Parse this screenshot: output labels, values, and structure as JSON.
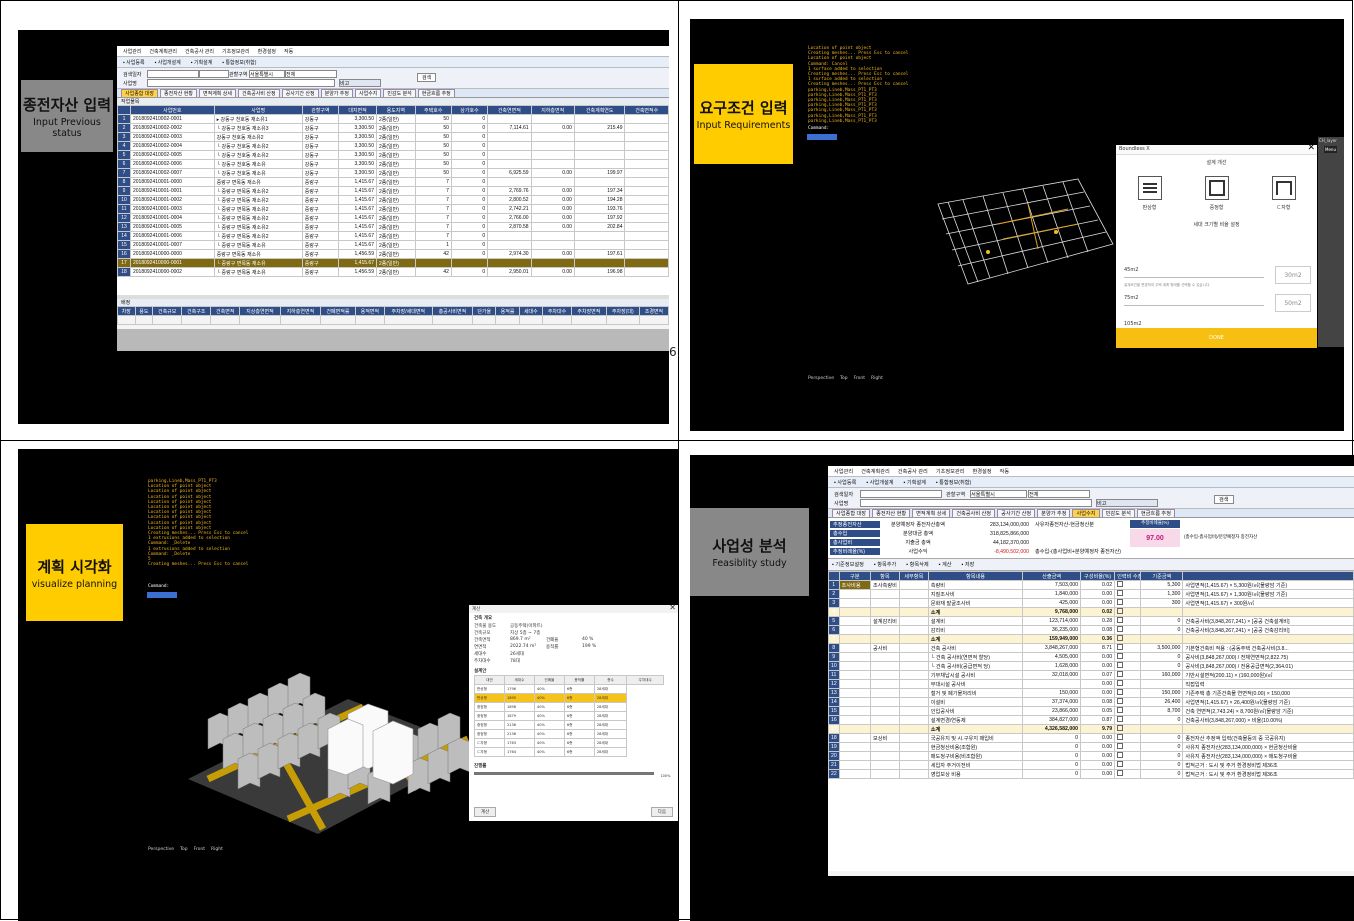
{
  "quadrants": {
    "tl": {
      "title": "종전자산 입력",
      "subtitle": "Input Previous status"
    },
    "tr": {
      "title": "요구조건 입력",
      "subtitle": "Input Requirements"
    },
    "bl": {
      "title": "계획 시각화",
      "subtitle": "visualize planning"
    },
    "br": {
      "title": "사업성 분석",
      "subtitle": "Feasiblity study"
    }
  },
  "page_number_fragment": "615",
  "app": {
    "menu": [
      "사업관리",
      "건축계획관리",
      "건축공사 관리",
      "기초정보관리",
      "환경설정",
      "작동"
    ],
    "toolbar": [
      "사업등록",
      "사업개설계",
      "기획설계",
      "통합정보(취합)"
    ],
    "filter": {
      "label_search": "검색일자",
      "label_name": "사업명",
      "label_region": "관할구역",
      "region_value": "서울특별시",
      "region_value2": "전체",
      "btn_search": "검색",
      "btn_note": "비고"
    },
    "tabs": [
      "사업종합 대장",
      "종전자산 현황",
      "면적계획 상세",
      "건축공사비 산정",
      "공사기간 산정",
      "분양가 추정",
      "사업수지",
      "민감도 분석",
      "현금흐름 추정"
    ]
  },
  "tl_table": {
    "section_label": "작업물목",
    "headers": [
      "사업번호",
      "사업명",
      "관할구역",
      "대지면적",
      "용도지역",
      "주택호수",
      "상가호수",
      "건축연면적",
      "지하층면적",
      "건축계획연도",
      "건축면적수",
      "건축면적비율"
    ],
    "rows": [
      [
        "2018092410002-0001",
        "▸ 강동구 천호동 재소유1",
        "강동구",
        "3,300.50",
        "2종(일반)",
        "50",
        "0",
        "",
        "",
        "",
        ""
      ],
      [
        "2018092410002-0002",
        "└ 강동구 천호동 재소유3",
        "강동구",
        "3,300.50",
        "2종(일반)",
        "50",
        "0",
        "7,114.61",
        "0.00",
        "215.49",
        ""
      ],
      [
        "2018092410002-0003",
        "강동구 천호동 재소유2",
        "강동구",
        "3,300.50",
        "2종(일반)",
        "50",
        "0",
        "",
        "",
        "",
        ""
      ],
      [
        "2018092410002-0004",
        "└ 강동구 천호동 재소유2",
        "강동구",
        "3,300.50",
        "2종(일반)",
        "50",
        "0",
        "",
        "",
        "",
        ""
      ],
      [
        "2018092410002-0005",
        "└ 강동구 천호동 재소유2",
        "강동구",
        "3,300.50",
        "2종(일반)",
        "50",
        "0",
        "",
        "",
        "",
        ""
      ],
      [
        "2018092410002-0006",
        "└ 강동구 천호동 재소유",
        "강동구",
        "3,300.50",
        "2종(일반)",
        "50",
        "0",
        "",
        "",
        "",
        ""
      ],
      [
        "2018092410002-0007",
        "└ 강동구 천호동 재소유",
        "강동구",
        "3,300.50",
        "2종(일반)",
        "50",
        "0",
        "6,925.59",
        "0.00",
        "199.97",
        ""
      ],
      [
        "2018092410001-0000",
        "중랑구 면목동 재소유",
        "중랑구",
        "1,415.67",
        "2종(일반)",
        "7",
        "0",
        "",
        "",
        "",
        ""
      ],
      [
        "2018092410001-0001",
        "└ 중랑구 면목동 재소유2",
        "중랑구",
        "1,415.67",
        "2종(일반)",
        "7",
        "0",
        "2,769.76",
        "0.00",
        "197.34",
        ""
      ],
      [
        "2018092410001-0002",
        "└ 중랑구 면목동 재소유2",
        "중랑구",
        "1,415.67",
        "2종(일반)",
        "7",
        "0",
        "2,800.52",
        "0.00",
        "194.28",
        ""
      ],
      [
        "2018092410001-0003",
        "└ 중랑구 면목동 재소유2",
        "중랑구",
        "1,415.67",
        "2종(일반)",
        "7",
        "0",
        "2,742.21",
        "0.00",
        "193.76",
        ""
      ],
      [
        "2018092410001-0004",
        "└ 중랑구 면목동 재소유2",
        "중랑구",
        "1,415.67",
        "2종(일반)",
        "7",
        "0",
        "2,766.00",
        "0.00",
        "197.92",
        ""
      ],
      [
        "2018092410001-0005",
        "└ 중랑구 면목동 재소유2",
        "중랑구",
        "1,415.67",
        "2종(일반)",
        "7",
        "0",
        "2,870.58",
        "0.00",
        "202.84",
        ""
      ],
      [
        "2018092410001-0006",
        "└ 중랑구 면목동 재소유2",
        "중랑구",
        "1,415.67",
        "2종(일반)",
        "7",
        "0",
        "",
        "",
        "",
        ""
      ],
      [
        "2018092410001-0007",
        "└ 중랑구 면목동 재소유",
        "중랑구",
        "1,415.67",
        "2종(일반)",
        "1",
        "0",
        "",
        "",
        "",
        ""
      ],
      [
        "2018092410000-0000",
        "중랑구 면목동 재소유",
        "중랑구",
        "1,456.59",
        "2종(일반)",
        "42",
        "0",
        "2,974.30",
        "0.00",
        "197.61",
        ""
      ],
      [
        "2018092410000-0001",
        "└ 중랑구 면목동 재소유",
        "중랑구",
        "1,415.67",
        "2종(일반)",
        "",
        "",
        "",
        "",
        "",
        ""
      ],
      [
        "2018092410000-0002",
        "└ 중랑구 면목동 재소유",
        "중랑구",
        "1,456.59",
        "2종(일반)",
        "42",
        "0",
        "2,950.01",
        "0.00",
        "196.98",
        ""
      ]
    ],
    "lower_label": "배정",
    "lower_headers": [
      "차장",
      "용도",
      "건축규모",
      "건축구조",
      "건축면적",
      "지상층연면적",
      "지하층연면적",
      "건폐면적률",
      "용적면적",
      "주차장/세대면적",
      "총공사비면적",
      "단가율",
      "용적률",
      "세대수",
      "주차대수",
      "주차장면적",
      "주차장(대)",
      "조경면적"
    ]
  },
  "tr_cad": {
    "log": [
      "Location of point object",
      "Creating meshes... Press Esc to cancel",
      "Location of point object",
      "Command: Cancel",
      "1 surface added to selection",
      "Creating meshes... Press Esc to cancel",
      "1 surface added to selection",
      "Creating meshes... Press Esc to cancel",
      "parking,Lineb,Mass_PT1_PT3",
      "parking,Lineb,Mass_PT1_PT3",
      "parking,Lineb,Mass_PT1_PT3",
      "parking,Lineb,Mass_PT1_PT3",
      "parking,Lineb,Mass_PT1_PT3",
      "parking,Lineb,Mass_PT1_PT3",
      "parking,Lineb,Mass_PT1_PT3"
    ],
    "command_label": "Command:",
    "views": [
      "Perspective",
      "Top",
      "Front",
      "Right"
    ],
    "dialog": {
      "title": "Boundless X",
      "section1": "설계 개선",
      "types": [
        "판상형",
        "중정형",
        "ㄷ자형"
      ],
      "section2": "세대 크기별 비율 설정",
      "units": [
        {
          "label": "45m2",
          "value": "30m2"
        },
        {
          "label": "75m2",
          "value": "50m2"
        },
        {
          "label": "105m2",
          "value": ""
        }
      ],
      "note": "설계조건을 변경하여 주택 계획 형태를 선택할 수 있습니다.",
      "done": "DONE"
    },
    "side_tab": "Menu",
    "side_label": "CH_layer"
  },
  "bl_cad": {
    "log": [
      "parking,Lineb,Mass_PT1_PT3",
      "Location of point object",
      "Location of point object",
      "Location of point object",
      "Location of point object",
      "Location of point object",
      "Location of point object",
      "Location of point object",
      "Location of point object",
      "Location of point object",
      "Creating meshes... Press Esc to cancel",
      "1 extrusions added to selection",
      "Command: _Delete",
      "1 extrusions added to selection",
      "Command: _Delete",
      "5",
      "Creating meshes... Press Esc to cancel"
    ],
    "command_label": "Command:",
    "views": [
      "Perspective",
      "Top",
      "Front",
      "Right"
    ],
    "panel": {
      "title": "계산",
      "section1": "건축 개요",
      "s1_rows": [
        [
          "건축물 용도",
          "공동주택(아파트)"
        ],
        [
          "건축규모",
          "지상 5층 ~ 7층"
        ],
        [
          "건축면적",
          "869.7 m²",
          "건폐율",
          "40 %"
        ],
        [
          "연면적",
          "2022.74 m²",
          "용적률",
          "199 %"
        ],
        [
          "세대수",
          "26세대"
        ],
        [
          "주차대수",
          "78대"
        ]
      ],
      "section2": "설계안",
      "s2_headers": [
        "대안",
        "세대수",
        "건폐율",
        "용적률",
        "층수",
        "주차대수"
      ],
      "s2_rows": [
        [
          "판상형",
          "1796",
          "40%",
          "6층",
          "28세대"
        ],
        [
          "판상형",
          "1895",
          "40%",
          "6층",
          "28세대"
        ],
        [
          "중정형",
          "1898",
          "40%",
          "6층",
          "28세대"
        ],
        [
          "중정형",
          "1879",
          "40%",
          "6층",
          "28세대"
        ],
        [
          "중정형",
          "2136",
          "40%",
          "6층",
          "28세대"
        ],
        [
          "중정형",
          "2136",
          "40%",
          "6층",
          "28세대"
        ],
        [
          "ㄷ자형",
          "1763",
          "40%",
          "6층",
          "28세대"
        ],
        [
          "ㄷ자형",
          "1764",
          "40%",
          "6층",
          "28세대"
        ]
      ],
      "section3": "진행률",
      "progress_text": "100%",
      "progress": 1.0,
      "btn_left": "계산",
      "btn_right": "다음"
    }
  },
  "br_app": {
    "summary": {
      "r1": [
        "추정종전자산",
        "분양예정자 종전자산총액",
        "283,134,000,000",
        "사유자종전자산-현금청산분"
      ],
      "r2": [
        "총수입",
        "분양대금 총액",
        "318,825,866,000"
      ],
      "r3": [
        "총사업비",
        "지출금 총액",
        "44,182,370,000"
      ],
      "r4": [
        "추정비례율(%)",
        "사업수익",
        "-8,490,502,000",
        "총수입-(총사업비+분양예정자 종전자산)"
      ],
      "ratio_label": "추정비례율(%)",
      "ratio_value": "97.00",
      "formula": "(총수입-총사업비)/분양예정자 종전자산"
    },
    "actions": [
      "기준정보설정",
      "항목추가",
      "항목삭제",
      "계산",
      "저장"
    ],
    "headers": [
      "구분",
      "항목",
      "세부항목",
      "항목내용",
      "산출금액",
      "구성비율(%)",
      "인력비 수정여부",
      "기준금액"
    ],
    "rows": [
      [
        "조사비용",
        "조사측량비",
        "",
        "측량비",
        "7,503,000",
        "0.02",
        "",
        "5,300",
        "사업면적(1,415.67) × 5,300원/㎡(물량암 기준)"
      ],
      [
        "",
        "",
        "",
        "지질조사비",
        "1,840,000",
        "0.00",
        "",
        "1,300",
        "사업면적(1,415.67) × 1,300원/㎡(물량암 기준)"
      ],
      [
        "",
        "",
        "",
        "문화재 발굴조사비",
        "425,000",
        "0.00",
        "",
        "300",
        "사업면적(1,415.67) × 300원/㎡"
      ],
      [
        "",
        "",
        "",
        "소계",
        "9,768,000",
        "0.02",
        "",
        "",
        ""
      ],
      [
        "",
        "설계감리비",
        "",
        "설계비",
        "123,714,000",
        "0.28",
        "",
        "0",
        "건축공사비(3,848,267,241) × [공공 건축설계비]"
      ],
      [
        "",
        "",
        "",
        "감리비",
        "36,235,000",
        "0.08",
        "",
        "0",
        "건축공사비(3,848,267,241) × [공공 건축감리비]"
      ],
      [
        "",
        "",
        "",
        "소계",
        "159,949,000",
        "0.36",
        "",
        "",
        ""
      ],
      [
        "",
        "공사비",
        "",
        "건축 공사비",
        "3,848,267,000",
        "8.71",
        "",
        "3,500,000",
        "기본형건축비 적용 : (공동주택 건축공사비(3.8..."
      ],
      [
        "",
        "",
        "",
        "└ 건축 공사비(연면적 할당)",
        "4,505,000",
        "0.00",
        "",
        "0",
        "공사비(3,848,267,000) / 전체연면적(2,822.75)"
      ],
      [
        "",
        "",
        "",
        "└ 건축 공사비(공급면적 당)",
        "1,628,000",
        "0.00",
        "",
        "0",
        "공사비(3,848,267,000) / 전용공급면적(2,364.01)"
      ],
      [
        "",
        "",
        "",
        "기부채납시설 공사비",
        "32,018,000",
        "0.07",
        "",
        "160,000",
        "기반시설면적(200.11) × (160,000원)/㎡"
      ],
      [
        "",
        "",
        "",
        "부대시설 공사비",
        "",
        "0.00",
        "",
        "",
        "직접입력"
      ],
      [
        "",
        "",
        "",
        "철거 및 폐기물처리비",
        "150,000",
        "0.00",
        "",
        "150,000",
        "기존주택 총 기존건축물 연면적(0.00) × 150,000"
      ],
      [
        "",
        "",
        "",
        "이설비",
        "37,374,000",
        "0.08",
        "",
        "26,400",
        "사업면적(1,415.67) × 26,400원/㎡(물량암 기준)"
      ],
      [
        "",
        "",
        "",
        "인입공사비",
        "23,866,000",
        "0.05",
        "",
        "8,700",
        "건축 연면적(2,743.24) × 8,700원/㎡(물량암 기준)"
      ],
      [
        "",
        "",
        "",
        "설계변경/연동제",
        "384,827,000",
        "0.87",
        "",
        "0",
        "건축공사비(3,848,267,000) × 비율(10.00%)"
      ],
      [
        "",
        "",
        "",
        "소계",
        "4,326,582,000",
        "9.79",
        "",
        "",
        ""
      ],
      [
        "",
        "보상비",
        "",
        "국공유지 및 시.구유지 매입비",
        "0",
        "0.00",
        "",
        "0",
        "종전자산 추정액 입력(건축물등의 중 국공유지)"
      ],
      [
        "",
        "",
        "",
        "현금청산비용(조합원)",
        "0",
        "0.00",
        "",
        "0",
        "사유지 종전자산(283,134,000,000) × 현금청산비율"
      ],
      [
        "",
        "",
        "",
        "매도청구비용(비조합원)",
        "0",
        "0.00",
        "",
        "0",
        "사유지 종전자산(283,134,000,000) × 매도청구비율"
      ],
      [
        "",
        "",
        "",
        "세입자 주거이전비",
        "0",
        "0.00",
        "",
        "0",
        "법적근거 : 도시 및 주거 환경정비법 제36조"
      ],
      [
        "",
        "",
        "",
        "영업보상 비용",
        "0",
        "0.00",
        "",
        "0",
        "법적근거 : 도시 및 주거 환경정비법 제36조"
      ]
    ]
  }
}
